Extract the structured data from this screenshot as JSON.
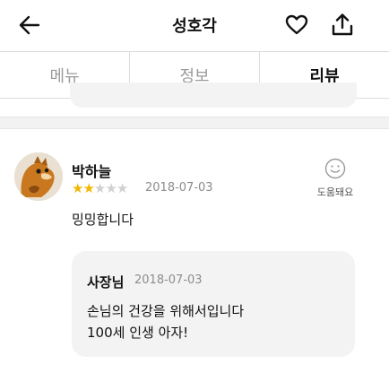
{
  "header": {
    "title": "성호각",
    "back_icon": "arrow-left-icon",
    "like_icon": "heart-outline-icon",
    "share_icon": "share-upload-icon"
  },
  "tabs": [
    {
      "label": "메뉴",
      "active": false
    },
    {
      "label": "정보",
      "active": false
    },
    {
      "label": "리뷰",
      "active": true
    }
  ],
  "review": {
    "author": "박하늘",
    "rating": 2,
    "rating_max": 5,
    "date": "2018-07-03",
    "helpful_label": "도움돼요",
    "helpful_icon": "smiley-icon",
    "text": "밍밍합니다",
    "reply": {
      "author": "사장님",
      "date": "2018-07-03",
      "lines": [
        "손님의 건강을 위해서입니다",
        "100세 인생 아자!"
      ]
    }
  },
  "colors": {
    "star_filled": "#f2b705",
    "star_empty": "#d0d0d0",
    "reply_background": "#f3f3f3"
  }
}
